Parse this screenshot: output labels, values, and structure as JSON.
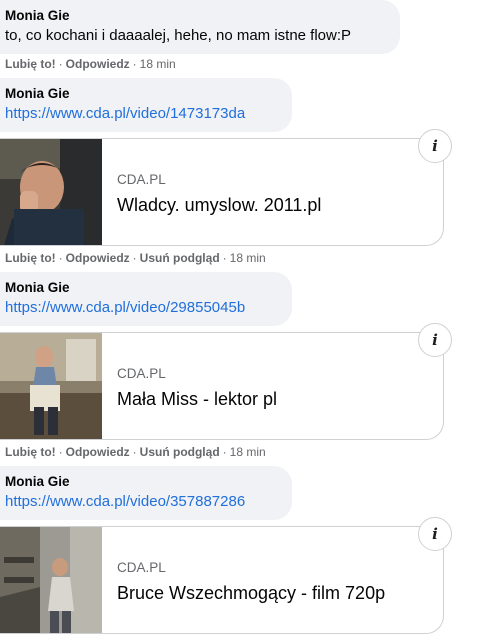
{
  "comments": [
    {
      "author": "Monia Gie",
      "text": "to, co kochani i daaaalej, hehe, no mam istne flow:P",
      "actions": {
        "like": "Lubię to!",
        "reply": "Odpowiedz",
        "time": "18 min"
      }
    },
    {
      "author": "Monia Gie",
      "link": "https://www.cda.pl/video/1473173da",
      "preview": {
        "domain": "CDA.PL",
        "title": "Wladcy. umyslow. 2011.pl",
        "info_icon": "info-icon"
      },
      "actions": {
        "like": "Lubię to!",
        "reply": "Odpowiedz",
        "remove_preview": "Usuń podgląd",
        "time": "18 min"
      }
    },
    {
      "author": "Monia Gie",
      "link": "https://www.cda.pl/video/29855045b",
      "preview": {
        "domain": "CDA.PL",
        "title": "Mała Miss - lektor pl",
        "info_icon": "info-icon"
      },
      "actions": {
        "like": "Lubię to!",
        "reply": "Odpowiedz",
        "remove_preview": "Usuń podgląd",
        "time": "18 min"
      }
    },
    {
      "author": "Monia Gie",
      "link": "https://www.cda.pl/video/357887286",
      "preview": {
        "domain": "CDA.PL",
        "title": "Bruce Wszechmogący - film 720p",
        "info_icon": "info-icon"
      }
    }
  ],
  "info_glyph": "i",
  "separator": "·",
  "colors": {
    "bubble": "#f0f2f5",
    "link": "#216fdb",
    "meta": "#65676b",
    "border": "#ced0d4"
  }
}
